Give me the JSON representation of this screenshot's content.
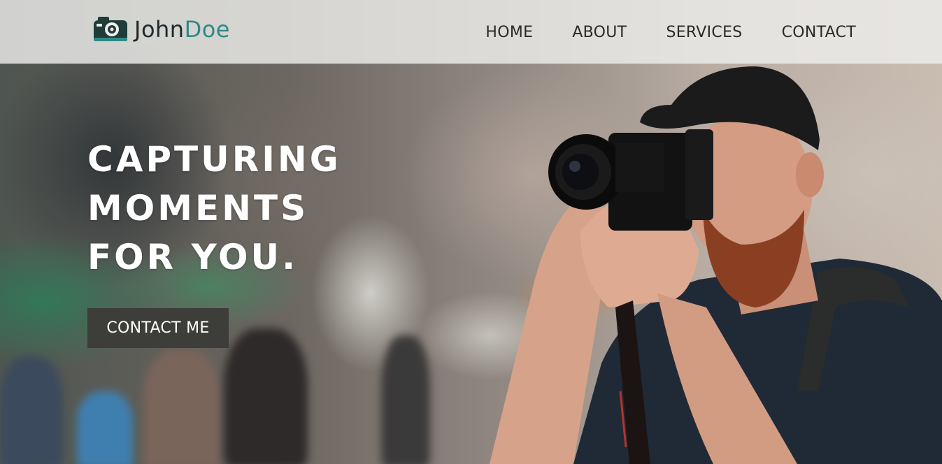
{
  "brand": {
    "first": "John",
    "last": "Doe",
    "icon": "camera-icon",
    "accent": "#2e8a86",
    "dark": "#1f2b2a"
  },
  "nav": {
    "items": [
      {
        "label": "HOME"
      },
      {
        "label": "ABOUT"
      },
      {
        "label": "SERVICES"
      },
      {
        "label": "CONTACT"
      }
    ]
  },
  "hero": {
    "lines": [
      "CAPTURING",
      "MOMENTS",
      "FOR YOU."
    ],
    "cta_label": "CONTACT ME"
  },
  "colors": {
    "header_bg": "#eeeeeb",
    "cta_bg": "#3d3d3a",
    "hero_text": "#ffffff"
  }
}
